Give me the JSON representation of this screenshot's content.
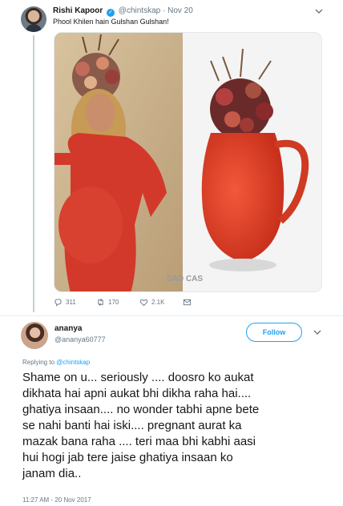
{
  "tweet": {
    "author_name": "Rishi Kapoor",
    "author_handle": "@chintskap",
    "date_separator": "·",
    "date": "Nov 20",
    "text": "Phool Khilen hain Gulshan Gulshan!",
    "media_watermark": "SAD CAS",
    "stats": {
      "replies": "311",
      "retweets": "170",
      "likes": "2.1K"
    }
  },
  "reply": {
    "author_name": "ananya",
    "author_handle": "@ananya60777",
    "follow_label": "Follow",
    "replying_to_prefix": "Replying to",
    "replying_to_handle": "@chintskap",
    "text_lines": [
      "Shame on u... seriously .... doosro ko aukat",
      "dikhata hai apni aukat bhi dikha raha hai....",
      "ghatiya insaan.... no wonder tabhi apne bete",
      "se nahi banti hai iski.... pregnant aurat ka",
      "mazak bana raha .... teri maa bhi kabhi aasi",
      "hui hogi jab tere jaise ghatiya insaan ko",
      "janam dia.."
    ],
    "timestamp": "11:27 AM - 20 Nov 2017"
  },
  "colors": {
    "accent": "#1da1f2",
    "muted_text": "#657786",
    "thread_line": "#c4cfd6",
    "divider": "#e6ecf0"
  },
  "icons": [
    "verified-badge-icon",
    "chevron-down-icon",
    "reply-icon",
    "retweet-icon",
    "like-icon",
    "message-icon"
  ]
}
